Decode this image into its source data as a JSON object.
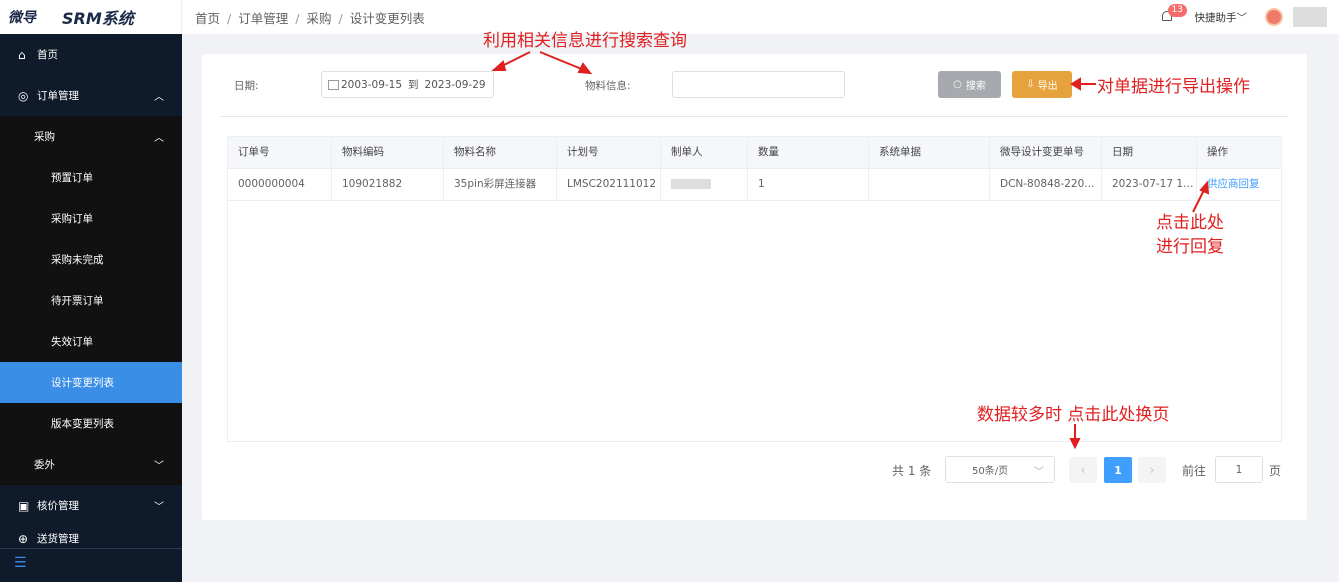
{
  "app": {
    "brand": "微导",
    "system_name": "SRM系统"
  },
  "header": {
    "breadcrumbs": [
      "首页",
      "订单管理",
      "采购",
      "设计变更列表"
    ],
    "separator": "/",
    "notification_count": "13",
    "helper_label": "快捷助手"
  },
  "sidebar": {
    "home": "首页",
    "order_mgmt": "订单管理",
    "purchase": "采购",
    "sub_items": [
      "预置订单",
      "采购订单",
      "采购未完成",
      "待开票订单",
      "失效订单",
      "设计变更列表",
      "版本变更列表"
    ],
    "outsource": "委外",
    "pricing": "核价管理",
    "partial": "送货管理"
  },
  "filters": {
    "date_label": "日期:",
    "date_from": "2003-09-15",
    "date_to_word": "到",
    "date_to": "2023-09-29",
    "material_label": "物料信息:",
    "material_value": "",
    "search_button": "搜索",
    "export_button": "导出"
  },
  "table": {
    "columns": [
      "订单号",
      "物料编码",
      "物料名称",
      "计划号",
      "制单人",
      "数量",
      "系统单据",
      "微导设计变更单号",
      "日期",
      "操作"
    ],
    "rows": [
      {
        "order_no": "0000000004",
        "material_code": "109021882",
        "material_name": "35pin彩屏连接器",
        "plan_no": "LMSC202111012",
        "creator": "",
        "quantity": "1",
        "system_doc": "",
        "change_no": "DCN-80848-220...",
        "date": "2023-07-17 19:...",
        "action": "供应商回复"
      }
    ]
  },
  "pagination": {
    "total_text": "共 1 条",
    "page_size": "50条/页",
    "current_page": "1",
    "goto_label": "前往",
    "goto_value": "1",
    "page_suffix": "页"
  },
  "annotations": {
    "search_hint": "利用相关信息进行搜索查询",
    "export_hint": "对单据进行导出操作",
    "reply_hint_1": "点击此处",
    "reply_hint_2": "进行回复",
    "paging_hint": "数据较多时 点击此处换页"
  },
  "colors": {
    "sidebar_bg": "#0f1a2b",
    "active": "#3a8ee6",
    "annotation": "#e02020",
    "export": "#e6a23c",
    "link": "#409eff"
  }
}
